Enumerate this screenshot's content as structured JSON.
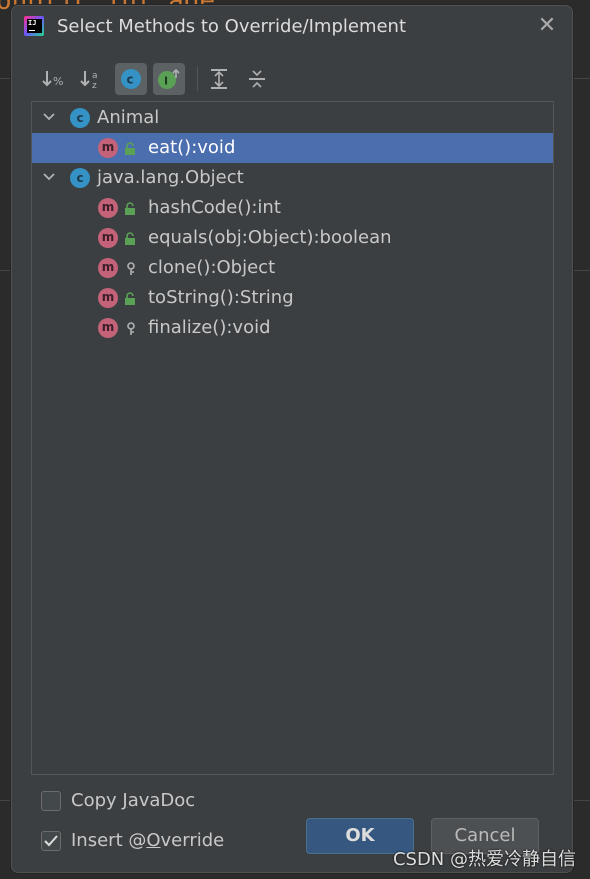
{
  "background": {
    "top_fragment": "oublic int age;"
  },
  "dialog": {
    "title": "Select Methods to Override/Implement",
    "close_glyph": "✕",
    "toolbar": [
      {
        "name": "sort-by-visibility-icon",
        "active": false
      },
      {
        "name": "sort-alphabetically-icon",
        "active": false
      },
      {
        "name": "group-by-class-icon",
        "active": true
      },
      {
        "name": "show-interfaces-icon",
        "active": true
      },
      {
        "name": "expand-all-icon",
        "active": false
      },
      {
        "name": "collapse-all-icon",
        "active": false
      }
    ],
    "tree": {
      "groups": [
        {
          "class_name": "Animal",
          "class_icon_letter": "c",
          "methods": [
            {
              "label": "eat():void",
              "visibility": "public",
              "selected": true
            }
          ]
        },
        {
          "class_name": "java.lang.Object",
          "class_icon_letter": "c",
          "methods": [
            {
              "label": "hashCode():int",
              "visibility": "public",
              "selected": false
            },
            {
              "label": "equals(obj:Object):boolean",
              "visibility": "public",
              "selected": false
            },
            {
              "label": "clone():Object",
              "visibility": "protected",
              "selected": false
            },
            {
              "label": "toString():String",
              "visibility": "public",
              "selected": false
            },
            {
              "label": "finalize():void",
              "visibility": "protected",
              "selected": false
            }
          ]
        }
      ],
      "method_icon_letter": "m"
    },
    "options": {
      "copy_javadoc": {
        "label_pre": "Copy ",
        "label_mnemonic": "J",
        "label_post": "avaDoc",
        "checked": false
      },
      "insert_override": {
        "label_pre": "Insert @",
        "label_mnemonic": "O",
        "label_post": "verride",
        "checked": true
      }
    },
    "buttons": {
      "ok": "OK",
      "cancel": "Cancel"
    }
  },
  "watermark": "CSDN @热爱冷静自信",
  "colors": {
    "selection": "#4b6eaf",
    "class_icon": "#3592c4",
    "method_icon": "#c4627a",
    "public_lock": "#5aa156",
    "ok_button": "#365880"
  }
}
